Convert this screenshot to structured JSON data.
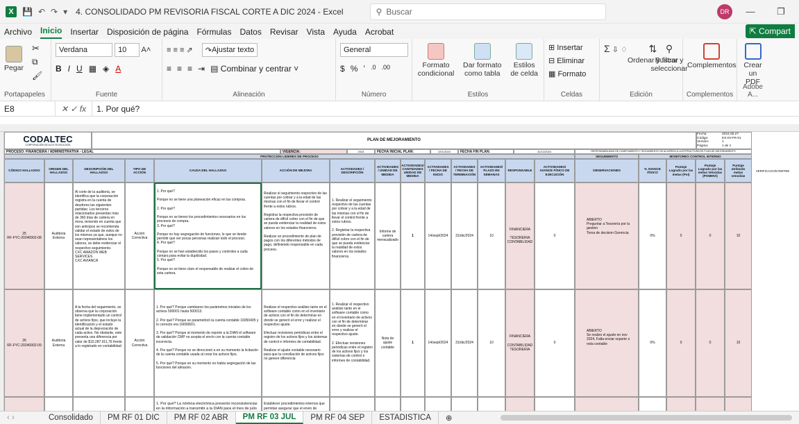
{
  "window": {
    "title": "4. CONSOLIDADO PM REVISORIA FISCAL CORTE A DIC 2024  -  Excel",
    "search_placeholder": "Buscar",
    "avatar_initials": "DR"
  },
  "menu": [
    "Archivo",
    "Inicio",
    "Insertar",
    "Disposición de página",
    "Fórmulas",
    "Datos",
    "Revisar",
    "Vista",
    "Ayuda",
    "Acrobat"
  ],
  "share_label": "Compart",
  "ribbon": {
    "paste": "Pegar",
    "font_name": "Verdana",
    "font_size": "10",
    "wrap_text": "Ajustar texto",
    "merge_center": "Combinar y centrar",
    "number_format": "General",
    "cond_format": "Formato condicional",
    "format_table": "Dar formato como tabla",
    "cell_styles": "Estilos de celda",
    "insert": "Insertar",
    "delete": "Eliminar",
    "format": "Formato",
    "sort_filter": "Ordenar y filtrar",
    "find_select": "Buscar y seleccionar",
    "complements": "Complementos",
    "create_pdf": "Crear un PDF",
    "groups": {
      "clipboard": "Portapapeles",
      "font": "Fuente",
      "alignment": "Alineación",
      "number": "Número",
      "styles": "Estilos",
      "cells": "Celdas",
      "editing": "Edición",
      "complements": "Complementos",
      "adobe": "Adobe A..."
    }
  },
  "formula_bar": {
    "name_box": "E8",
    "formula": "1. Por qué?"
  },
  "sheet": {
    "logo": "CODALTEC",
    "logo_sub": "CORPORACIÓN DE ALTA TECNOLOGÍA",
    "plan_title": "PLAN DE MEJORAMIENTO",
    "fecha_label": "Fecha:",
    "fecha_val": "2024.05.27",
    "codigo_label": "Código:",
    "codigo_val": "ES-IN-FR-01",
    "version_label": "Versión:",
    "version_val": "1",
    "pagina_label": "Página:",
    "pagina_val": "1 de 1",
    "proceso": "PROCESO: FINANCIERA / ADMINISTRATIVA - LEGAL",
    "vigencia": "VIGENCIA:",
    "vigencia_val": "2024",
    "fecha_inicial": "FECHA INICIAL PLAN:",
    "fecha_inicial_val": "2/01/2024",
    "fecha_fin": "FECHA FIN PLAN:",
    "fecha_fin_val": "31/12/2024",
    "responsabilidad": "RESPONSABILIDAD DE CUMPLIMIENTO Y SEGUIMIENTO DE ACUERDO A LA ESTRUCTURA DE PLAN DE MEJORAMIENTO",
    "proteccion": "PROTECCION LIDERES DE PROCESO",
    "seguimiento": "SEGUIMIENTO",
    "monitoreo": "MONITOREO CONTROL INTERNO",
    "headers": [
      "CÓDIGO HALLAZGO",
      "ORIGEN DEL HALLAZGO",
      "DESCRIPCIÓN DEL HALLAZGO",
      "TIPO DE ACCIÓN",
      "CAUSA DEL HALLAZGO",
      "ACCIÓN DE MEJORA",
      "ACTIVIDADES / DESCRIPCIÓN",
      "ACTIVIDADES / UNIDAD DE MEDIDA",
      "ACTIVIDADES/ CANTIDADES UNIDAD DE MEDIDA",
      "ACTIVIDADES / FECHA DE INICIO",
      "ACTIVIDADES / FECHA DE TERMINACIÓN",
      "ACTIVIDADES/ PLAZO EN SEMANAS",
      "RESPONSABLE",
      "ACTIVIDADES/ AVANCE FÍSICO DE EJECUCIÓN",
      "OBSERVACIONES",
      "% AVANCE FÍSICO",
      "Puntaje Logrado por las metas (Poi)",
      "Puntaje Logrado por las metas Vencidas (POMMVi)",
      "Puntaje atribuido metas vencidas",
      "VERIFICACION REFRIE"
    ],
    "rows": [
      {
        "codigo": "25\nRF-FYC-20240902-08",
        "origen": "Auditoria Externa",
        "descripcion": "Al corte de la auditoria, se identifica que la corporación registra en la cuenta de deudores las siguientes partidas: Los terceros relacionados presentan más de 360 días de cartera en mora, teniendo en cuenta que son anticipos se recomienda validar el estado de estos de los mismos ya que, aunque no sean representativos los valores, se debe evidenciar el respectivo seguimiento.\nCXC AMAZON WEB SERVICES\nCXC AVIANCA",
        "tipo": "Acción Correctiva",
        "causa": "1. Por qué?\n\nPorque no se tiene una planeación eficaz en las compras.\n\n2. Por qué?\n\nPorque no se tienen los procedimientos necesarios en los procesos de compra.\n3. Por qué?\n\nPorque no hay segregación de funciones, lo que se tiende permitir que ver pocas personas realizan todo el proceso.\n4. Por qué?\n\nPorque no se han establecido los pasos y controles a cada compra para evitar la duplicidad.\n5. Por qué?\n\nPorque no se tiene claro el responsable de realizar el cobro de esta cartera.",
        "accion": "Realizar el seguimiento respectivo de las cuentas por cobrar y a la edad de las mismas con el fin de llevar el control frente a estos rubros.\n\nRegistrar la respectiva provisión de cartera de difícil cobro con el fin de que se pueda evidenciar la realidad de estos valores en los estados financieros.\n\nRealizar un procedimiento de plan de pagos con los diferentes métodos de pago, definiendo responsable en cada proceso.",
        "actividad": "1. Realizar el seguimiento respectivo de las cuentas por cobrar y a la edad de las mismas con el fin de llevar el control frente a estos rubros.\n\n2. Registrar la respectiva provisión de cartera de difícil cobro con el fin de que se pueda evidenciar la realidad de estos valores en los estados financieros.",
        "unidad": "Informe de cartera mensualizado",
        "cantidad": "1",
        "inicio": "14/sept/2024",
        "fin": "31/dic/2024",
        "plazo": "10",
        "responsable": "FINANCIERA\n\nTESORERIA\nCONTABILIDAD",
        "avance": "0",
        "observaciones": "ABIERTO\nPreguntar a Tesorería por la gestion\nToma de decision Gerencia",
        "pct": "0%",
        "p1": "0",
        "p2": "0",
        "p3": "10"
      },
      {
        "codigo": "26\nRF-FYC-20240902-09",
        "origen": "Auditoria Externa",
        "descripcion": "A la fecha del seguimiento, se observa que la corporación tiene implementado un control de activos fijos, que incluye la identificación y el estado actual de la depreciación de cada activo. No obstante, este presenta una diferencia por valor de $10.287.911,76 frente a lo registrado en contabilidad.",
        "tipo": "Acción Correctiva",
        "causa": "1. Por qué? Porque cambiaron los parámetros iniciales de los activos 500001 hasta 500013.\n\n2. Por qué? Porque se parametrizó la cuenta contable 16050405 y lo correcto era 16650601.\n\n3. Por qué? Porque al momento de reporte a la DIAN el software de validación CMP no acepta el envío con la cuenta contable incorrecta.\n\n4. Por qué? Porque no se direccionó a en su momento la licitación de la cuenta contable usada al crear los activos fijos.\n\n5. Por qué? Porque en su momento no había segregación de las funciones del almacén.",
        "accion": "Realizar el respectivo análisis tanto en el software contable como en el inventario de activos con el fin de determinar en donde se generó el error y realizar el respectivo ajuste.\n\nEfectuar revisiones periódicas entre el registro de los activos fijos y los sistemas de control e informes de contabilidad.\n\nRealizar el ajuste contable necesario para que la conciliación de activos fijos no genere diferencia",
        "actividad": "1. Realizar el respectivo análisis tanto en el software contable como en el inventario de activos con el fin de determinar en donde se generó el error y realizar el respectivo ajuste.\n\n2. Efectuar revisiones periódicas entre el registro de los activos fijos y los sistemas de control e informes de contabilidad.",
        "unidad": "Nota de ajuste contable",
        "cantidad": "1",
        "inicio": "14/sept/2024",
        "fin": "31/dic/2024",
        "plazo": "10",
        "responsable": "FINANCIERA\n\nCONTABILIDAD\nTESORERIA",
        "avance": "0",
        "observaciones": "ABIERTO\nSe realizo el ajuste en nov 2024, Falta enviar soporte o nota contable",
        "pct": "0%",
        "p1": "0",
        "p2": "0",
        "p3": "10"
      },
      {
        "causa": "1. Por qué? La nómina electrónica presento inconsistencias en la información a transmitir a la DIAN para el mes de julio 2024.",
        "accion": "Establecer procedimientos internos que permitan asegurar que el envío de"
      }
    ]
  },
  "tabs": [
    "Consolidado",
    "PM RF 01 DIC",
    "PM RF 02 ABR",
    "PM RF 03 JUL",
    "PM RF 04 SEP",
    "ESTADISTICA"
  ],
  "active_tab": "PM RF 03 JUL"
}
